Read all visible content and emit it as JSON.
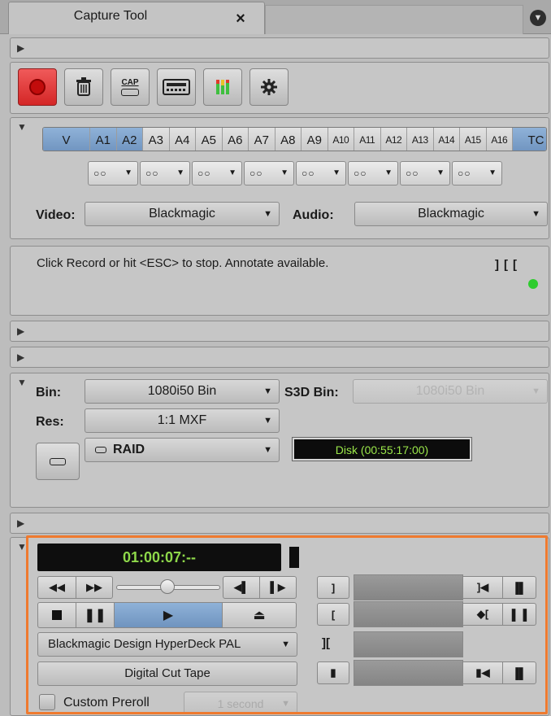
{
  "window": {
    "tab_title": "Capture Tool",
    "close_glyph": "×",
    "menu_icon": "chevron-down-circle-icon"
  },
  "toolbar": {
    "record_icon": "record-icon",
    "trash_icon": "trash-icon",
    "cap_label": "CAP",
    "deck_icon": "deck-icon",
    "meters_icon": "audio-meters-icon",
    "settings_icon": "gear-icon",
    "record_color": "#e23b3b"
  },
  "tracks": {
    "items": [
      "V",
      "A1",
      "A2",
      "A3",
      "A4",
      "A5",
      "A6",
      "A7",
      "A8",
      "A9",
      "A10",
      "A11",
      "A12",
      "A13",
      "A14",
      "A15",
      "A16",
      "TC"
    ],
    "selected": [
      "V",
      "A1",
      "A2",
      "TC"
    ],
    "pair_values": [
      "○○",
      "○○",
      "○○",
      "○○",
      "○○",
      "○○",
      "○○",
      "○○"
    ]
  },
  "sources": {
    "video_label": "Video:",
    "video_value": "Blackmagic",
    "audio_label": "Audio:",
    "audio_value": "Blackmagic"
  },
  "status": {
    "message": "Click Record or hit <ESC> to stop. Annotate available.",
    "indicator_color": "#2ecc2e"
  },
  "bins": {
    "bin_label": "Bin:",
    "bin_value": "1080i50 Bin",
    "s3d_label": "S3D Bin:",
    "s3d_value": "1080i50 Bin",
    "res_label": "Res:",
    "res_value": "1:1  MXF",
    "drive_value": "RAID",
    "disk_text": "Disk (00:55:17:00)"
  },
  "deck": {
    "timecode": "01:00:07:--",
    "deck_name": "Blackmagic Design HyperDeck PAL",
    "digital_cut_label": "Digital Cut Tape",
    "custom_preroll_label": "Custom Preroll",
    "preroll_value": "1 second",
    "accent_color": "#ef7a2f"
  }
}
